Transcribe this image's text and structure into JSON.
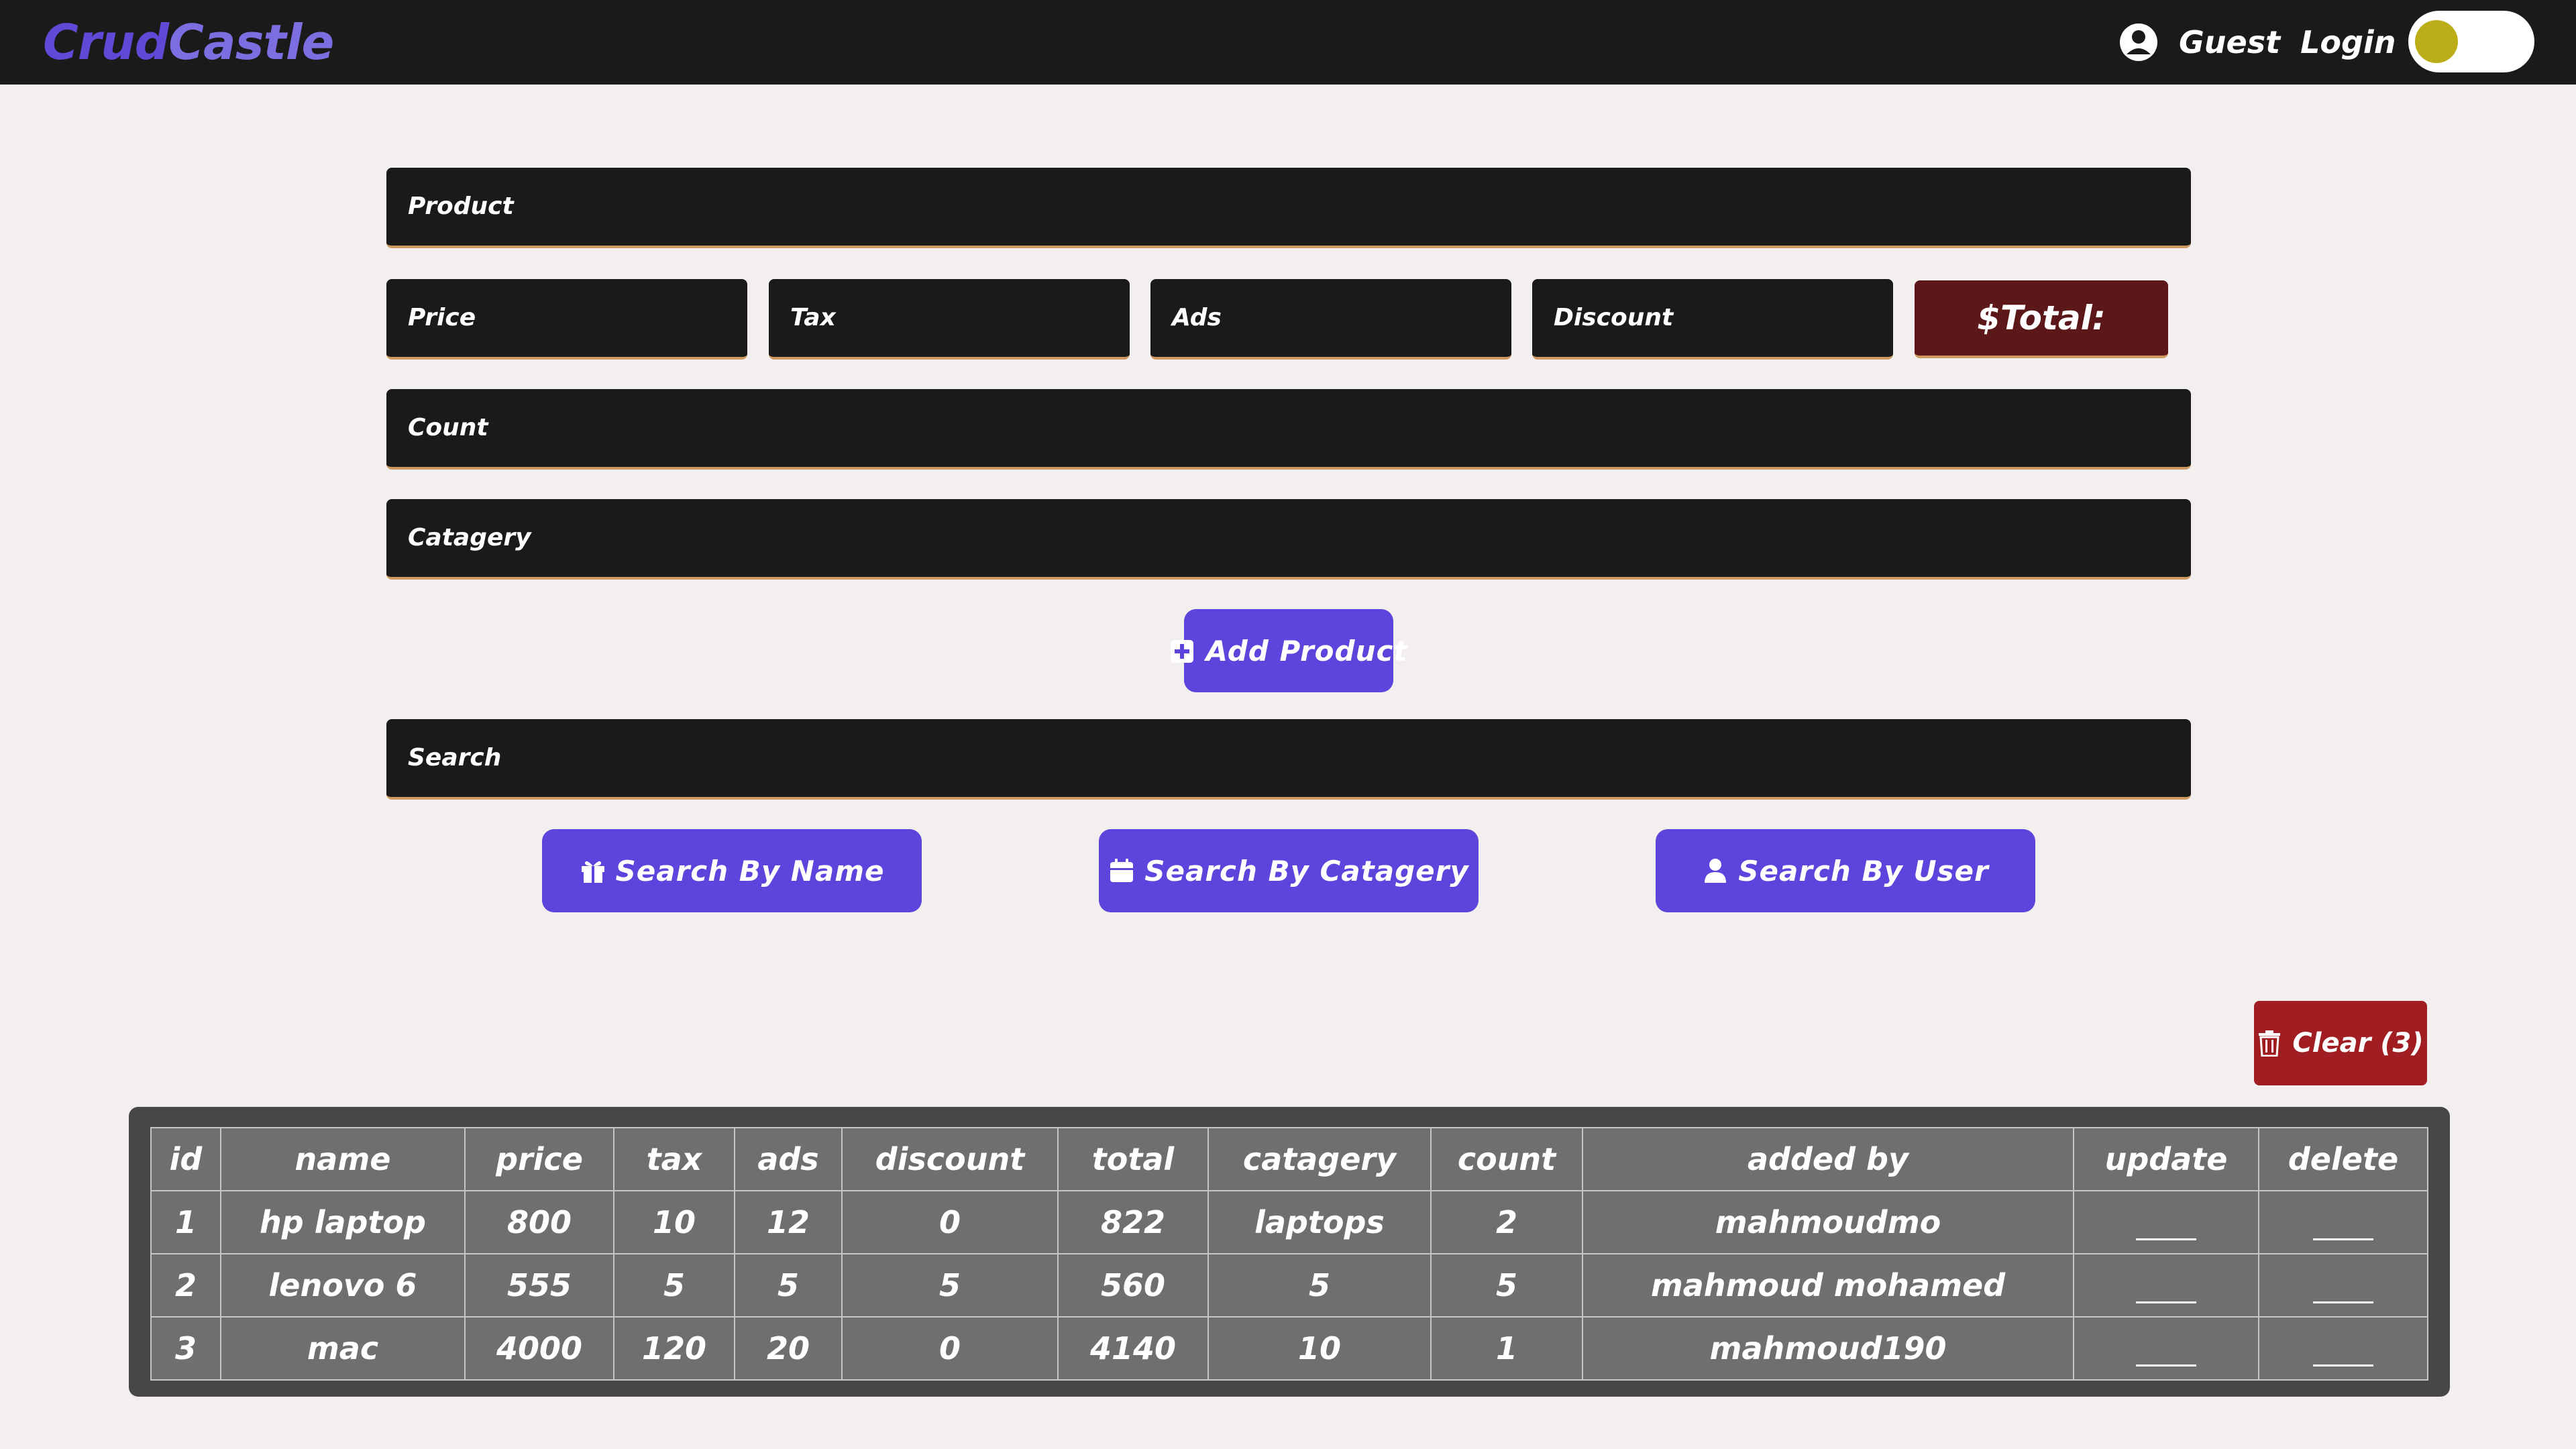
{
  "nav": {
    "logo_part1": "Crud",
    "logo_part2": "Castle",
    "user_name": "Guest",
    "login_label": "Login",
    "icons": {
      "user": "user-circle-icon"
    },
    "theme_toggle_knob_color": "#bcae18"
  },
  "form": {
    "product_placeholder": "Product",
    "price_placeholder": "Price",
    "tax_placeholder": "Tax",
    "ads_placeholder": "Ads",
    "discount_placeholder": "Discount",
    "total_label": "$Total:",
    "count_placeholder": "Count",
    "category_placeholder": "Catagery",
    "add_button_label": "Add Product",
    "add_button_icon": "plus-square-icon"
  },
  "search": {
    "placeholder": "Search",
    "by_name_label": "Search By Name",
    "by_name_icon": "gift-icon",
    "by_category_label": "Search By Catagery",
    "by_category_icon": "calendar-icon",
    "by_user_label": "Search By User",
    "by_user_icon": "user-icon"
  },
  "clear": {
    "label": "Clear (3)",
    "icon": "trash-icon"
  },
  "table": {
    "headers": {
      "id": "id",
      "name": "name",
      "price": "price",
      "tax": "tax",
      "ads": "ads",
      "discount": "discount",
      "total": "total",
      "category": "catagery",
      "count": "count",
      "added_by": "added by",
      "update": "update",
      "delete": "delete"
    },
    "rows": [
      {
        "id": "1",
        "name": "hp laptop",
        "price": "800",
        "tax": "10",
        "ads": "12",
        "discount": "0",
        "total": "822",
        "category": "laptops",
        "count": "2",
        "added_by": "mahmoudmo"
      },
      {
        "id": "2",
        "name": "lenovo 6",
        "price": "555",
        "tax": "5",
        "ads": "5",
        "discount": "5",
        "total": "560",
        "category": "5",
        "count": "5",
        "added_by": "mahmoud mohamed"
      },
      {
        "id": "3",
        "name": "mac",
        "price": "4000",
        "tax": "120",
        "ads": "20",
        "discount": "0",
        "total": "4140",
        "category": "10",
        "count": "1",
        "added_by": "mahmoud190"
      }
    ]
  },
  "colors": {
    "accent": "#5c45dc",
    "danger": "#a01d22",
    "total_bg": "#5c1818",
    "nav_bg": "#1a1a1a",
    "page_bg": "#f3efee"
  }
}
